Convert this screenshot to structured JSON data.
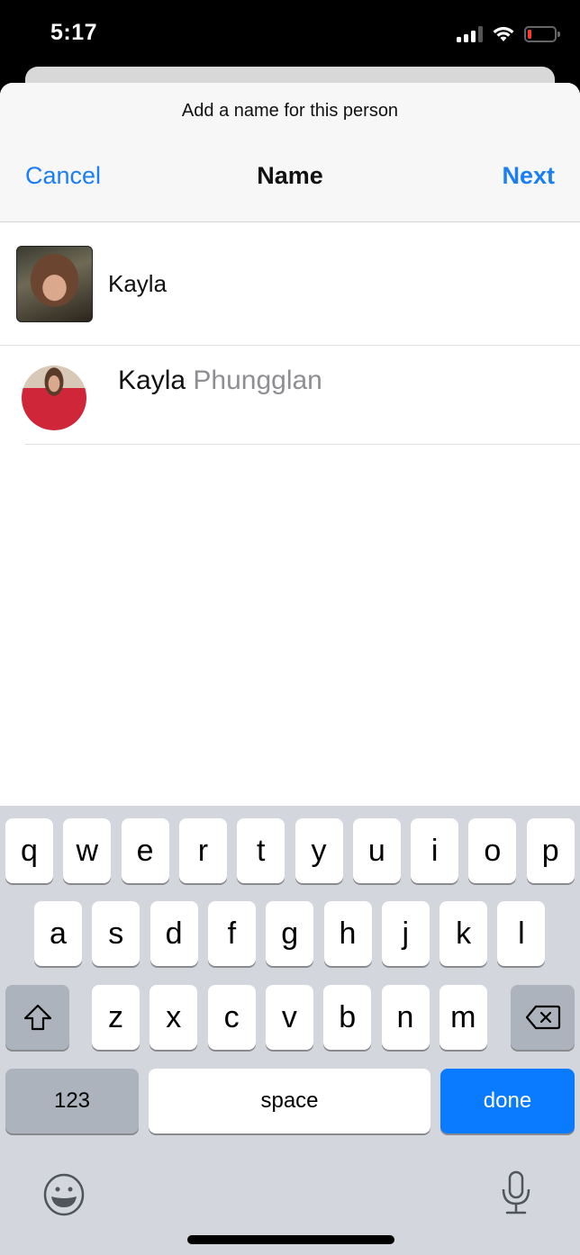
{
  "status_bar": {
    "time": "5:17",
    "icons": [
      "cellular-signal-icon",
      "wifi-icon",
      "battery-low-icon"
    ],
    "battery_color": "#ff3b30"
  },
  "sheet": {
    "prompt": "Add a name for this person",
    "nav": {
      "cancel_label": "Cancel",
      "title": "Name",
      "next_label": "Next"
    },
    "accent_color": "#1a7ef5"
  },
  "name_field": {
    "value": "Kayla",
    "thumbnail": "face-photo"
  },
  "suggestions": [
    {
      "first": "Kayla",
      "last": "Phungglan",
      "avatar": "contact-photo"
    }
  ],
  "keyboard": {
    "row1": [
      "q",
      "w",
      "e",
      "r",
      "t",
      "y",
      "u",
      "i",
      "o",
      "p"
    ],
    "row2": [
      "a",
      "s",
      "d",
      "f",
      "g",
      "h",
      "j",
      "k",
      "l"
    ],
    "row3": [
      "z",
      "x",
      "c",
      "v",
      "b",
      "n",
      "m"
    ],
    "numbers_label": "123",
    "space_label": "space",
    "done_label": "done",
    "done_color": "#0a7aff",
    "icons": [
      "shift-icon",
      "delete-icon",
      "emoji-icon",
      "microphone-icon"
    ]
  }
}
